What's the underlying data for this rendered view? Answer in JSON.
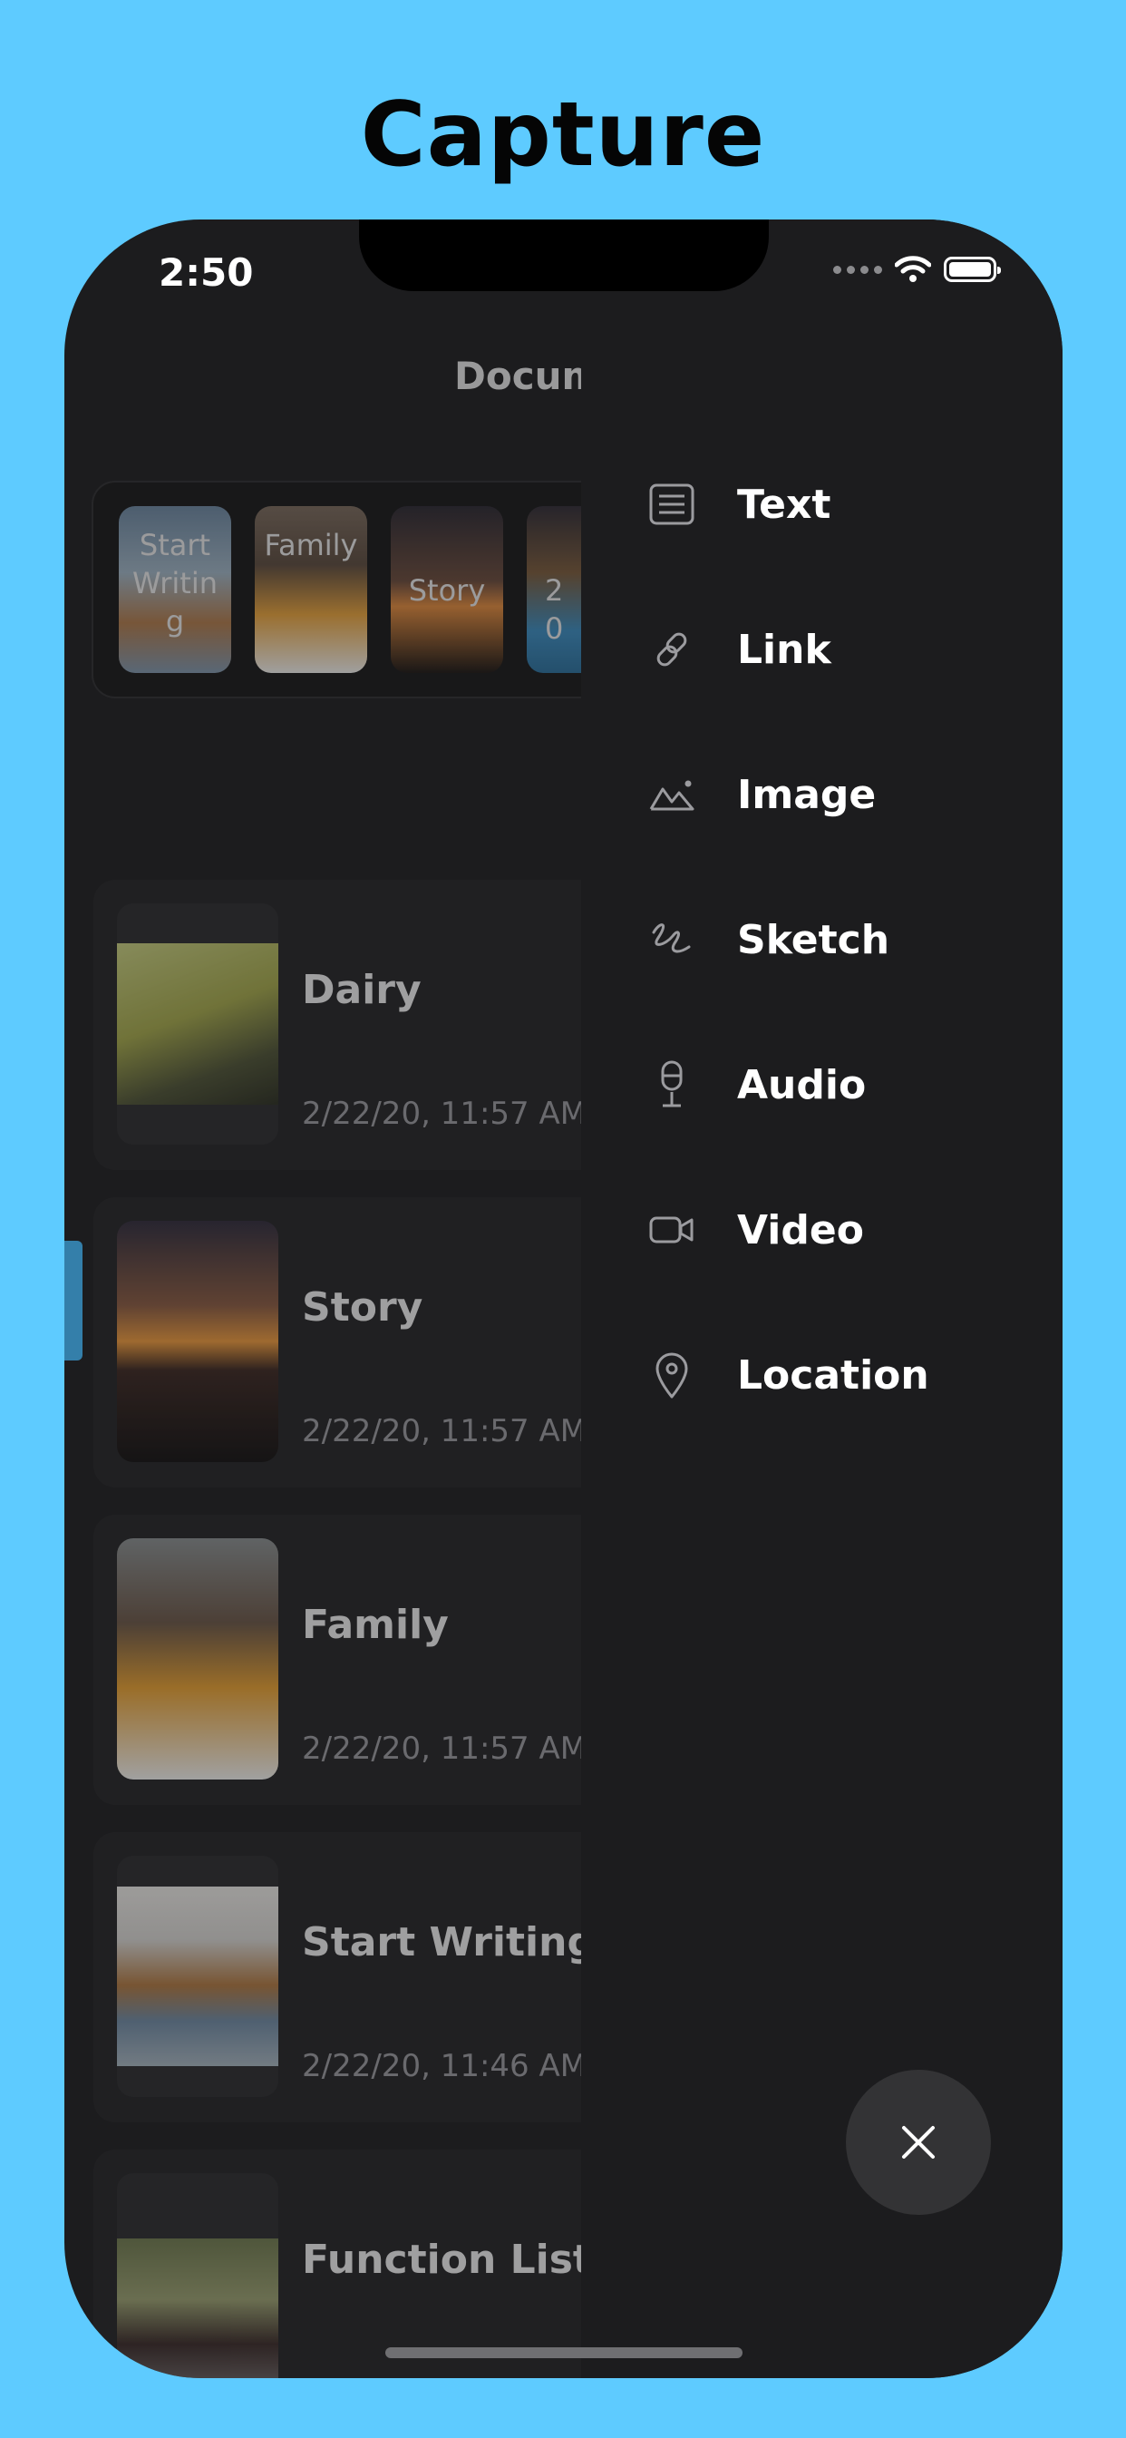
{
  "headline": "Capture",
  "status_bar": {
    "time": "2:50"
  },
  "documents": {
    "title": "Documents",
    "title_visible": "Docum",
    "thumbnails": [
      {
        "label": "Start Writing",
        "image": "dog-photo"
      },
      {
        "label": "Family",
        "image": "beer-glasses-photo"
      },
      {
        "label": "Story",
        "image": "sunset-photo"
      },
      {
        "label": "20",
        "image": "blue-photo"
      }
    ],
    "items": [
      {
        "title": "Dairy",
        "date": "2/22/20, 11:57 AM",
        "image": "car-photo"
      },
      {
        "title": "Story",
        "date": "2/22/20, 11:57 AM",
        "image": "sunset-photo"
      },
      {
        "title": "Family",
        "date": "2/22/20, 11:57 AM",
        "image": "beer-glasses-photo"
      },
      {
        "title": "Start Writing",
        "date": "2/22/20, 11:46 AM",
        "image": "dog-photo"
      },
      {
        "title": "Function List",
        "date": "",
        "image": "motorcycle-photo"
      }
    ]
  },
  "menu": {
    "items": [
      {
        "label": "Text",
        "icon": "text-icon"
      },
      {
        "label": "Link",
        "icon": "link-icon"
      },
      {
        "label": "Image",
        "icon": "image-icon"
      },
      {
        "label": "Sketch",
        "icon": "sketch-icon"
      },
      {
        "label": "Audio",
        "icon": "microphone-icon"
      },
      {
        "label": "Video",
        "icon": "video-icon"
      },
      {
        "label": "Location",
        "icon": "location-pin-icon"
      }
    ],
    "close_icon": "close-icon"
  },
  "colors": {
    "background": "#5ecbff",
    "phone_surface": "#1c1c1e",
    "card": "#232325",
    "accent_tab": "#3fa9e6"
  }
}
